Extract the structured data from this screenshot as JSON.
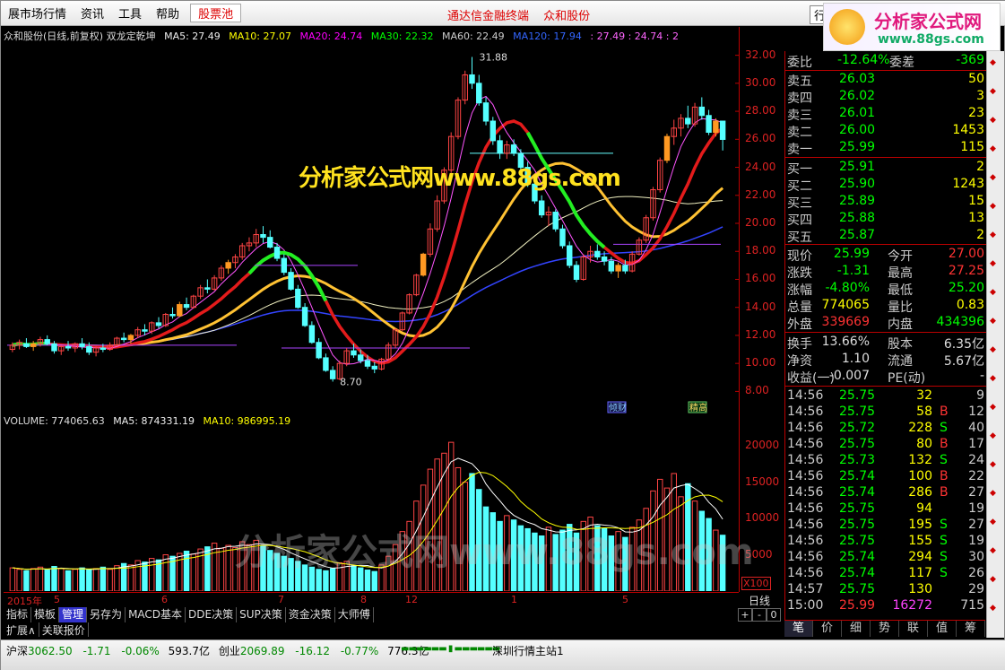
{
  "menu": {
    "items": [
      "展市场行情",
      "资讯",
      "工具",
      "帮助"
    ],
    "stockpool": "股票池",
    "center_title": "通达信金融终端",
    "stock_name": "众和股份",
    "right_button": "行"
  },
  "logo": {
    "title": "分析家公式网",
    "url": "www.88gs.com"
  },
  "main_info": {
    "title": "众和股份(日线,前复权) 双龙定乾坤",
    "ma5": "MA5: 27.49",
    "ma10": "MA10: 27.07",
    "ma20": "MA20: 24.74",
    "ma30": "MA30: 22.32",
    "ma60": "MA60: 22.49",
    "ma120": "MA120: 17.94",
    "tail": ": 27.49  : 24.74  : 2"
  },
  "y_axis_labels": [
    "32.00",
    "30.00",
    "28.00",
    "26.00",
    "24.00",
    "22.00",
    "20.00",
    "18.00",
    "16.00",
    "14.00",
    "12.00",
    "10.00",
    "8.00"
  ],
  "chart_annotations": {
    "high": "31.88",
    "low": "8.70",
    "tag1": "倾财",
    "tag2": "精高"
  },
  "vol_info": {
    "volume": "VOLUME: 774065.63",
    "ma5": "MA5: 874331.19",
    "ma10": "MA10: 986995.19"
  },
  "vol_axis_labels": [
    "20000",
    "15000",
    "10000",
    "5000"
  ],
  "vol_unit": "X100",
  "date_labels": [
    "2015年",
    "5",
    "6",
    "7",
    "8",
    "12",
    "1",
    "5"
  ],
  "tabs": [
    "指标",
    "模板",
    "管理",
    "另存为",
    "MACD基本",
    "DDE决策",
    "SUP决策",
    "资金决策",
    "大师傅"
  ],
  "tabs2": [
    "扩展∧",
    "关联报价"
  ],
  "period": "日线",
  "ctrl": [
    "+",
    "-",
    "0"
  ],
  "quote": {
    "weibi_label": "委比",
    "weibi": "-12.64%",
    "weicha_label": "委差",
    "weicha": "-369",
    "sell": [
      {
        "l": "卖五",
        "p": "26.03",
        "v": "50"
      },
      {
        "l": "卖四",
        "p": "26.02",
        "v": "3"
      },
      {
        "l": "卖三",
        "p": "26.01",
        "v": "23"
      },
      {
        "l": "卖二",
        "p": "26.00",
        "v": "1453"
      },
      {
        "l": "卖一",
        "p": "25.99",
        "v": "115"
      }
    ],
    "buy": [
      {
        "l": "买一",
        "p": "25.91",
        "v": "2"
      },
      {
        "l": "买二",
        "p": "25.90",
        "v": "1243"
      },
      {
        "l": "买三",
        "p": "25.89",
        "v": "15"
      },
      {
        "l": "买四",
        "p": "25.88",
        "v": "13"
      },
      {
        "l": "买五",
        "p": "25.87",
        "v": "2"
      }
    ],
    "stats": [
      {
        "l1": "现价",
        "v1": "25.99",
        "l2": "今开",
        "v2": "27.00"
      },
      {
        "l1": "涨跌",
        "v1": "-1.31",
        "l2": "最高",
        "v2": "27.25"
      },
      {
        "l1": "涨幅",
        "v1": "-4.80%",
        "l2": "最低",
        "v2": "25.20"
      },
      {
        "l1": "总量",
        "v1": "774065",
        "l2": "量比",
        "v2": "0.83"
      },
      {
        "l1": "外盘",
        "v1": "339669",
        "l2": "内盘",
        "v2": "434396"
      }
    ],
    "finance": [
      {
        "l1": "换手",
        "v1": "13.66%",
        "l2": "股本",
        "v2": "6.35亿"
      },
      {
        "l1": "净资",
        "v1": "1.10",
        "l2": "流通",
        "v2": "5.67亿"
      },
      {
        "l1": "收益(一)",
        "v1": "-0.007",
        "l2": "PE(动)",
        "v2": "-"
      }
    ],
    "ticks": [
      [
        "14:56",
        "25.75",
        "32",
        "",
        "9"
      ],
      [
        "14:56",
        "25.75",
        "58",
        "B",
        "12"
      ],
      [
        "14:56",
        "25.72",
        "228",
        "S",
        "40"
      ],
      [
        "14:56",
        "25.75",
        "80",
        "B",
        "17"
      ],
      [
        "14:56",
        "25.73",
        "132",
        "S",
        "24"
      ],
      [
        "14:56",
        "25.74",
        "100",
        "B",
        "22"
      ],
      [
        "14:56",
        "25.74",
        "286",
        "B",
        "27"
      ],
      [
        "14:56",
        "25.75",
        "94",
        "",
        "19"
      ],
      [
        "14:56",
        "25.75",
        "195",
        "S",
        "27"
      ],
      [
        "14:56",
        "25.75",
        "155",
        "S",
        "19"
      ],
      [
        "14:56",
        "25.74",
        "294",
        "S",
        "30"
      ],
      [
        "14:56",
        "25.74",
        "117",
        "S",
        "26"
      ],
      [
        "14:57",
        "25.75",
        "130",
        "",
        "29"
      ],
      [
        "15:00",
        "25.99",
        "16272",
        "",
        "715"
      ]
    ]
  },
  "bottom_tabs": [
    "笔",
    "价",
    "细",
    "势",
    "联",
    "值",
    "筹"
  ],
  "status": {
    "sh_label": "沪深",
    "sh_val": "3062.50",
    "sh_chg": "-1.71",
    "sh_pct": "-0.06%",
    "sh_amt": "593.7亿",
    "cy_label": "创业",
    "cy_val": "2069.89",
    "cy_chg": "-16.12",
    "cy_pct": "-0.77%",
    "cy_amt": "776.3亿",
    "station": "深圳行情主站1"
  },
  "watermark": {
    "main": "分析家公式网www.88gs.com",
    "faint": "分析家公式网www.88gs.com"
  },
  "chart_data": {
    "type": "candlestick",
    "title": "众和股份(日线,前复权) 双龙定乾坤",
    "ylim": [
      7,
      33
    ],
    "y_ticks": [
      8,
      10,
      12,
      14,
      16,
      18,
      20,
      22,
      24,
      26,
      28,
      30,
      32
    ],
    "candles": [
      [
        11,
        11.5,
        10.8,
        11.3
      ],
      [
        11.3,
        11.7,
        11,
        11.5
      ],
      [
        11.4,
        11.8,
        11.1,
        11.2
      ],
      [
        11.2,
        11.6,
        10.9,
        11.4
      ],
      [
        11.4,
        11.9,
        11.2,
        11.7
      ],
      [
        11.7,
        12,
        11.3,
        11.4
      ],
      [
        11.4,
        11.6,
        10.7,
        10.9
      ],
      [
        10.9,
        11.3,
        10.6,
        11.2
      ],
      [
        11.2,
        11.6,
        10.9,
        11.1
      ],
      [
        11.1,
        11.5,
        10.8,
        11.4
      ],
      [
        11.4,
        11.8,
        11,
        11.2
      ],
      [
        11.2,
        11.5,
        10.6,
        10.8
      ],
      [
        10.8,
        11.2,
        10.5,
        11.1
      ],
      [
        11.1,
        11.4,
        10.8,
        11
      ],
      [
        11,
        11.5,
        10.9,
        11.3
      ],
      [
        11.3,
        11.9,
        11.2,
        11.8
      ],
      [
        11.8,
        12.2,
        11.5,
        11.7
      ],
      [
        11.7,
        12.1,
        11.4,
        12
      ],
      [
        12,
        12.6,
        11.8,
        12.4
      ],
      [
        12.4,
        12.8,
        12,
        12.3
      ],
      [
        12.3,
        13,
        12.1,
        12.9
      ],
      [
        12.9,
        13.3,
        12.5,
        12.7
      ],
      [
        12.7,
        13.6,
        12.6,
        13.5
      ],
      [
        13.5,
        14,
        13.2,
        13.4
      ],
      [
        13.4,
        14.4,
        13.3,
        14.2
      ],
      [
        14.2,
        14.7,
        13.8,
        14
      ],
      [
        14,
        14.9,
        13.9,
        14.8
      ],
      [
        14.8,
        15.6,
        14.6,
        15.4
      ],
      [
        15.4,
        16,
        15,
        15.3
      ],
      [
        15.3,
        16.3,
        15.2,
        16.1
      ],
      [
        16.1,
        17,
        15.9,
        16.8
      ],
      [
        16.8,
        17.4,
        16.4,
        17.2
      ],
      [
        17.2,
        17.8,
        16.8,
        17.6
      ],
      [
        17.6,
        18.6,
        17.4,
        18.4
      ],
      [
        18.4,
        19,
        18,
        18.6
      ],
      [
        18.6,
        19.6,
        18.3,
        19.2
      ],
      [
        19.2,
        19.8,
        18.6,
        19
      ],
      [
        19,
        19.5,
        18.2,
        18.3
      ],
      [
        18.3,
        18.6,
        17.3,
        17.5
      ],
      [
        17.5,
        17.8,
        16.3,
        16.5
      ],
      [
        16.5,
        16.8,
        15.2,
        15.3
      ],
      [
        15.3,
        15.6,
        13.9,
        14
      ],
      [
        14,
        14.3,
        12.6,
        12.7
      ],
      [
        12.7,
        13,
        11.4,
        11.5
      ],
      [
        11.5,
        11.8,
        10.3,
        10.4
      ],
      [
        10.4,
        10.7,
        9.4,
        9.5
      ],
      [
        9.5,
        9.8,
        8.7,
        8.9
      ],
      [
        8.9,
        10.2,
        8.8,
        10
      ],
      [
        10,
        11.1,
        9.8,
        10.9
      ],
      [
        10.9,
        11.4,
        10.4,
        10.6
      ],
      [
        10.6,
        11,
        10,
        10.2
      ],
      [
        10.2,
        10.6,
        9.6,
        9.8
      ],
      [
        9.8,
        10.1,
        9.3,
        9.6
      ],
      [
        9.6,
        10.4,
        9.5,
        10.3
      ],
      [
        10.3,
        11.5,
        10.2,
        11.3
      ],
      [
        11.3,
        12.5,
        11.1,
        12.4
      ],
      [
        12.4,
        13.7,
        12.3,
        13.6
      ],
      [
        13.6,
        15,
        13.5,
        14.9
      ],
      [
        14.9,
        16.4,
        14.8,
        16.3
      ],
      [
        16.3,
        17.9,
        16.2,
        17.8
      ],
      [
        17.8,
        20,
        17.6,
        19.6
      ],
      [
        19.6,
        22,
        19.4,
        21.6
      ],
      [
        21.6,
        24,
        21.4,
        23.8
      ],
      [
        23.8,
        26.5,
        23.6,
        26.2
      ],
      [
        26.2,
        29,
        26,
        28.8
      ],
      [
        28.8,
        30.9,
        28.5,
        30.6
      ],
      [
        30.6,
        31.88,
        29.6,
        30
      ],
      [
        30,
        30.6,
        28.4,
        28.6
      ],
      [
        28.6,
        29,
        27,
        27.3
      ],
      [
        27.3,
        27.6,
        25.6,
        25.9
      ],
      [
        25.9,
        26.3,
        24.6,
        25
      ],
      [
        25,
        25.9,
        24.6,
        25.6
      ],
      [
        25.6,
        26,
        24.8,
        25
      ],
      [
        25,
        25.3,
        23.8,
        24
      ],
      [
        24,
        24.4,
        22.6,
        22.8
      ],
      [
        22.8,
        23.2,
        21.4,
        21.6
      ],
      [
        21.6,
        22,
        20.4,
        20.6
      ],
      [
        20.6,
        21.2,
        19.8,
        20.8
      ],
      [
        20.8,
        21,
        19.4,
        19.6
      ],
      [
        19.6,
        19.9,
        18.2,
        18.4
      ],
      [
        18.4,
        18.7,
        16.8,
        17
      ],
      [
        17,
        17.3,
        15.8,
        16
      ],
      [
        16,
        17.8,
        15.9,
        17.6
      ],
      [
        17.6,
        18.4,
        17.2,
        18
      ],
      [
        18,
        18.5,
        17.4,
        17.6
      ],
      [
        17.6,
        18,
        17,
        17.3
      ],
      [
        17.3,
        17.6,
        16.4,
        16.6
      ],
      [
        16.6,
        17.2,
        16.1,
        17
      ],
      [
        17,
        17.4,
        16.4,
        16.6
      ],
      [
        16.6,
        18,
        16.5,
        17.8
      ],
      [
        17.8,
        19,
        17.7,
        18.8
      ],
      [
        18.8,
        20.6,
        18.6,
        20.4
      ],
      [
        20.4,
        22.6,
        20.2,
        22.4
      ],
      [
        22.4,
        24.7,
        22.2,
        24.5
      ],
      [
        24.5,
        26.4,
        24.3,
        26.2
      ],
      [
        26.2,
        27.4,
        25.6,
        26.8
      ],
      [
        26.8,
        27.8,
        26.2,
        27.5
      ],
      [
        27.5,
        28.4,
        26.8,
        27.1
      ],
      [
        27.1,
        28.6,
        26.9,
        28.3
      ],
      [
        28.3,
        29,
        27.4,
        27.7
      ],
      [
        27.7,
        28.1,
        26.3,
        26.5
      ],
      [
        26.5,
        27.5,
        26.2,
        27.3
      ],
      [
        27.3,
        27.25,
        25.2,
        25.99
      ]
    ],
    "volume": {
      "ylim": [
        0,
        22000
      ],
      "y_ticks": [
        5000,
        10000,
        15000,
        20000
      ],
      "values": [
        3200,
        3000,
        2800,
        3100,
        3300,
        2900,
        3400,
        3100,
        2800,
        3000,
        3200,
        2900,
        3100,
        3300,
        3000,
        3500,
        3800,
        3600,
        4200,
        4000,
        4500,
        4300,
        5000,
        4800,
        5200,
        5500,
        5100,
        5800,
        6100,
        6600,
        5900,
        6300,
        6000,
        6800,
        6400,
        7000,
        6200,
        5600,
        5200,
        4800,
        4500,
        4100,
        3600,
        3300,
        3000,
        2800,
        3100,
        3900,
        4100,
        3500,
        3200,
        2900,
        2700,
        3600,
        4800,
        6400,
        8200,
        9600,
        12400,
        14600,
        16800,
        18200,
        19000,
        20500,
        17000,
        15000,
        16200,
        14000,
        11600,
        10800,
        9600,
        10400,
        9800,
        9000,
        8600,
        8000,
        7600,
        8800,
        7800,
        8400,
        9200,
        8000,
        9600,
        10200,
        9000,
        8600,
        7600,
        8200,
        7400,
        8800,
        9800,
        11400,
        13800,
        15400,
        14200,
        16200,
        13000,
        14800,
        12400,
        11000,
        10000,
        8400,
        7700
      ],
      "ma5_label": "MA5",
      "ma10_label": "MA10"
    }
  }
}
